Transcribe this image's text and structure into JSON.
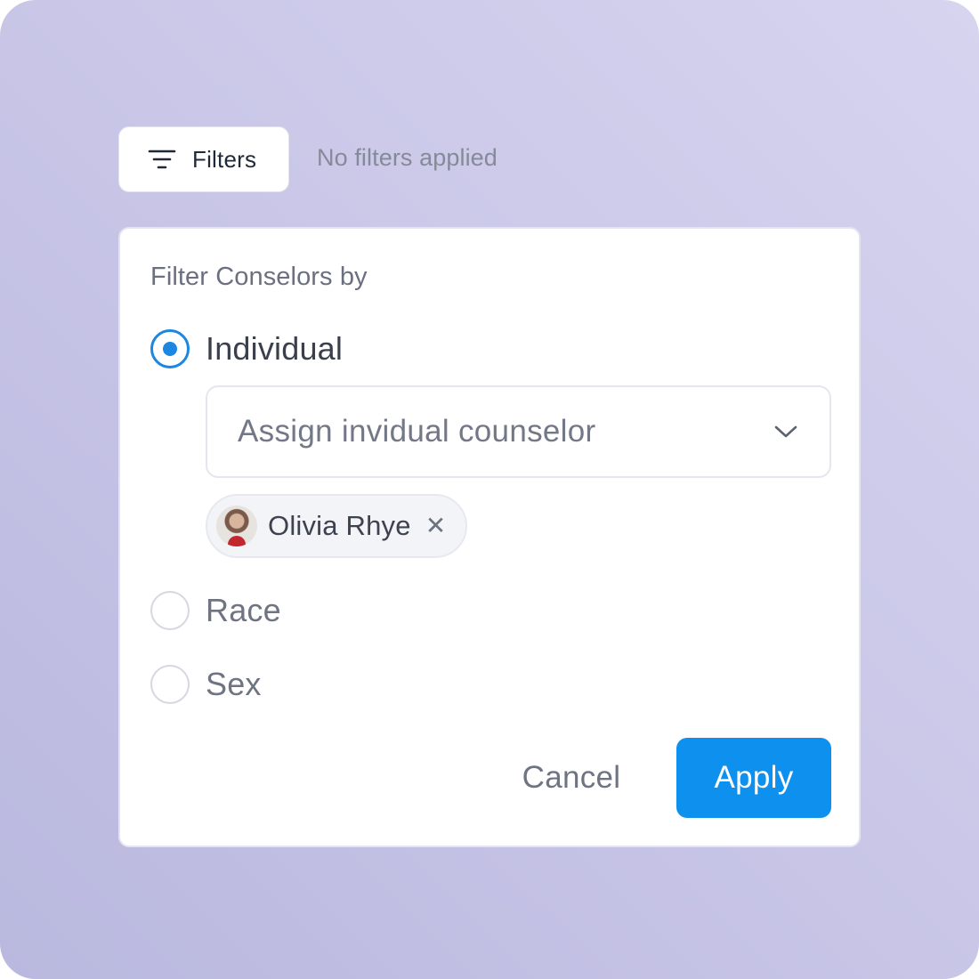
{
  "toolbar": {
    "filters_label": "Filters",
    "filters_icon": "filter-lines-icon",
    "status": "No filters applied"
  },
  "panel": {
    "title": "Filter Conselors by",
    "options": [
      {
        "label": "Individual",
        "checked": true
      },
      {
        "label": "Race",
        "checked": false
      },
      {
        "label": "Sex",
        "checked": false
      }
    ],
    "select": {
      "value": "Assign invidual counselor",
      "icon": "chevron-down-icon"
    },
    "chip": {
      "name": "Olivia Rhye",
      "remove_icon": "close-icon",
      "remove_glyph": "✕"
    },
    "actions": {
      "cancel": "Cancel",
      "apply": "Apply"
    }
  },
  "colors": {
    "accent": "#0d90ee",
    "radio_checked": "#1c87e0",
    "background": "#cac7e8"
  }
}
